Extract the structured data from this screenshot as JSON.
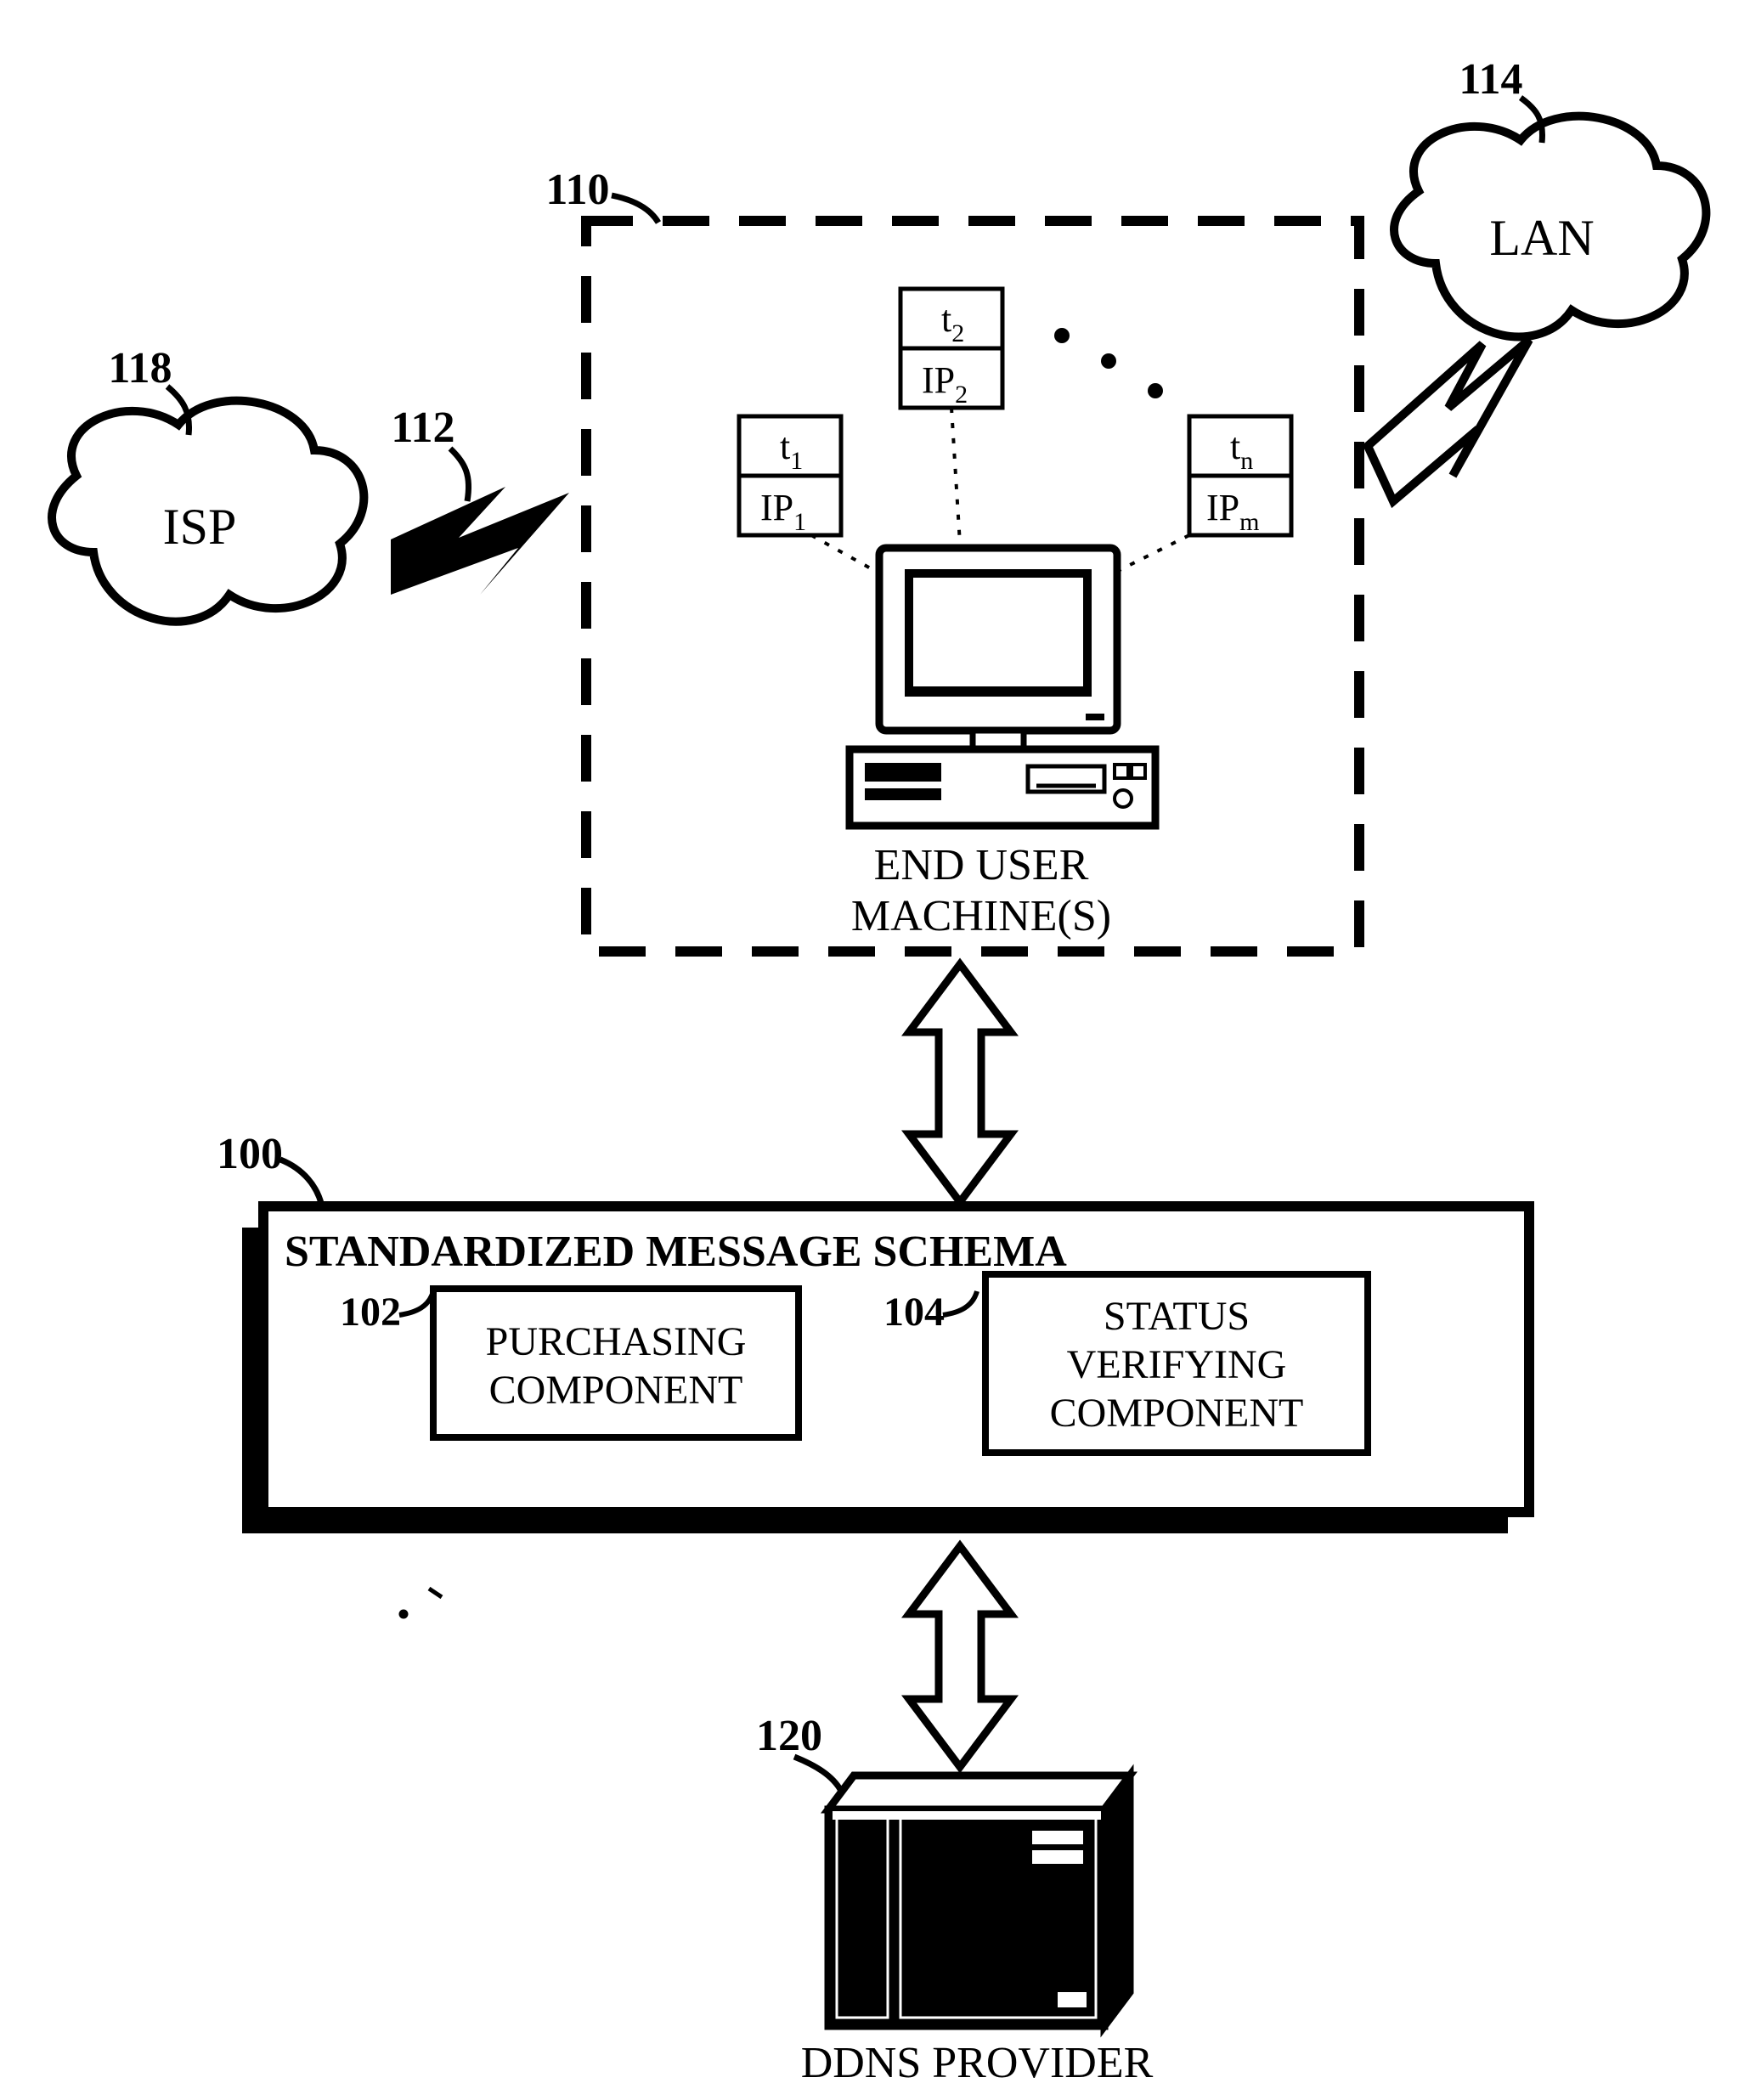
{
  "refs": {
    "schema": "100",
    "purchasing": "102",
    "status_verifying": "104",
    "user_box": "110",
    "conn_isp": "112",
    "lan": "114",
    "isp_ref": "118",
    "ddns": "120"
  },
  "clouds": {
    "isp": "ISP",
    "lan": "LAN"
  },
  "user_machine": {
    "label_line1": "END USER",
    "label_line2": "MACHINE(S)"
  },
  "ip_boxes": {
    "b1_top": "t",
    "b1_top_sub": "1",
    "b1_bot": "IP",
    "b1_bot_sub": "1",
    "b2_top": "t",
    "b2_top_sub": "2",
    "b2_bot": "IP",
    "b2_bot_sub": "2",
    "b3_top": "t",
    "b3_top_sub": "n",
    "b3_bot": "IP",
    "b3_bot_sub": "m"
  },
  "schema_box": {
    "title": "STANDARDIZED MESSAGE SCHEMA",
    "left_line1": "PURCHASING",
    "left_line2": "COMPONENT",
    "right_line1": "STATUS",
    "right_line2": "VERIFYING",
    "right_line3": "COMPONENT"
  },
  "ddns_label": "DDNS PROVIDER"
}
